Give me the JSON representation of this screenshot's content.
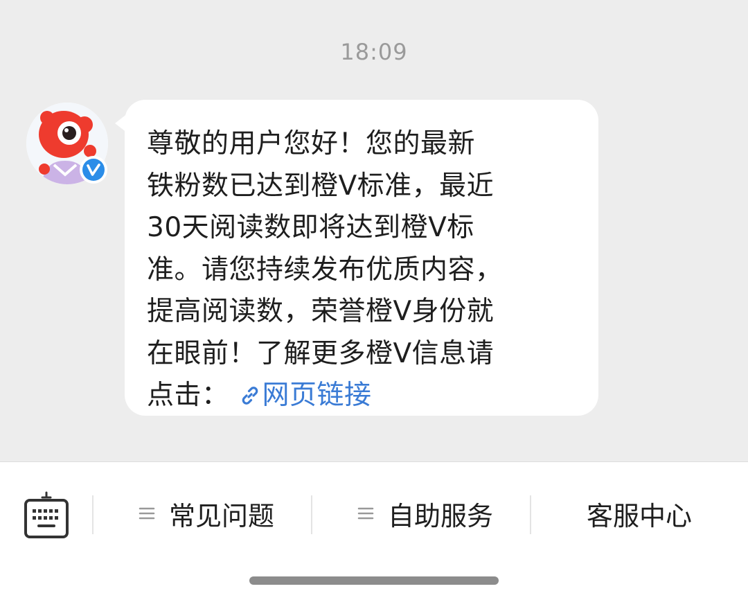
{
  "chat": {
    "timestamp": "18:09",
    "message": {
      "lines": [
        "尊敬的用户您好！您的最新",
        "铁粉数已达到橙V标准，最近",
        "30天阅读数即将达到橙V标",
        "准。请您持续发布优质内容，",
        "提高阅读数，荣誉橙V身份就",
        "在眼前！了解更多橙V信息请"
      ],
      "last_line_prefix": "点击：",
      "link_label": "网页链接",
      "link_icon": "link-icon"
    },
    "avatar": {
      "icon": "weibo-mascot-avatar",
      "badge_icon": "verified-badge-icon"
    }
  },
  "bottom_menu": {
    "keyboard_icon": "keyboard-icon",
    "items": [
      {
        "label": "常见问题",
        "icon": "menu-lines-icon"
      },
      {
        "label": "自助服务",
        "icon": "menu-lines-icon"
      },
      {
        "label": "客服中心"
      }
    ]
  },
  "colors": {
    "background": "#ededed",
    "bubble": "#ffffff",
    "link": "#3a7bd5",
    "text": "#1e1e1e",
    "timestamp": "#9a9a9a",
    "verified": "#2b8de8"
  }
}
